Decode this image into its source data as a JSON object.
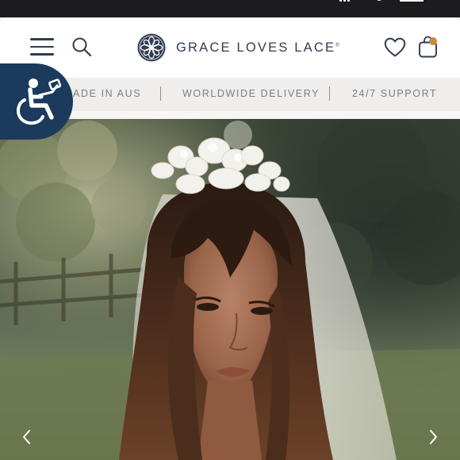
{
  "header": {
    "brand_name": "GRACE LOVES LACE",
    "brand_mark": "®"
  },
  "usp_bar": {
    "items": [
      "MADE IN AUS",
      "WORLDWIDE DELIVERY",
      "24/7 SUPPORT"
    ]
  },
  "icons": {
    "menu": "hamburger-menu-icon",
    "search": "search-icon",
    "wishlist": "heart-icon",
    "cart": "shopping-bag-icon",
    "accessibility": "wheelchair-accessibility-icon",
    "slide_prev": "chevron-left-icon",
    "slide_next": "chevron-right-icon"
  },
  "colors": {
    "brand": "#2f3b52",
    "accessibility_bg": "#1b3a5c",
    "cart_badge": "#c8883f",
    "usp_text": "#7a7d86",
    "usp_bg": "#efeeec"
  }
}
